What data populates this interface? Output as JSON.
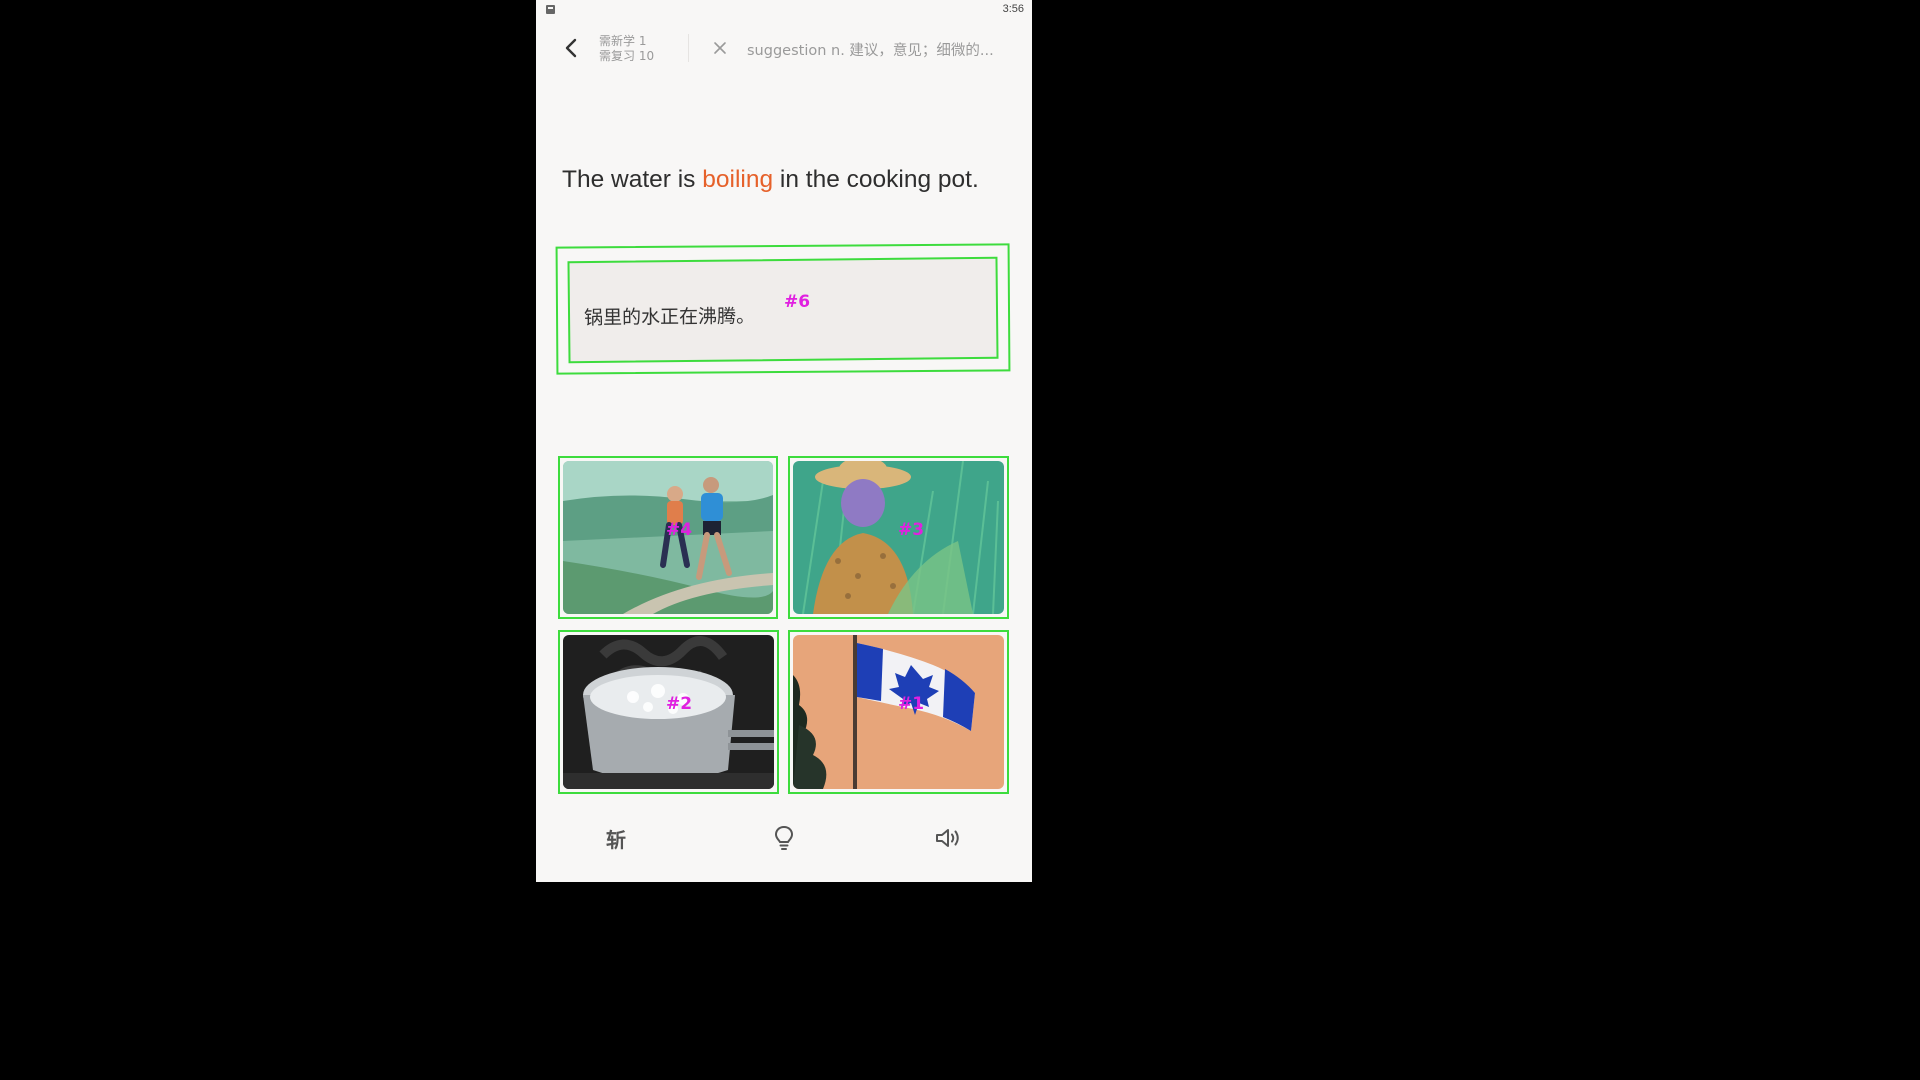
{
  "status_bar": {
    "time": "3:56"
  },
  "top_bar": {
    "new_count_label": "需新学 1",
    "review_count_label": "需复习 10",
    "previous_word": "suggestion n. 建议，意见；细微的..."
  },
  "sentence": {
    "before": "The water is ",
    "highlight": "boiling",
    "after": " in the cooking pot."
  },
  "translation": {
    "text": "锅里的水正在沸腾。",
    "tag": "#6"
  },
  "choices": [
    {
      "tag": "#4",
      "icon": "running-couple-image"
    },
    {
      "tag": "#3",
      "icon": "farmer-in-rice-field-image"
    },
    {
      "tag": "#2",
      "icon": "boiling-pot-image"
    },
    {
      "tag": "#1",
      "icon": "waving-flag-image"
    }
  ],
  "bottom_bar": {
    "chop_label": "斩"
  },
  "colors": {
    "highlight": "#e6612a",
    "box_outline": "#3ddc3d",
    "tag": "#e020e0"
  }
}
